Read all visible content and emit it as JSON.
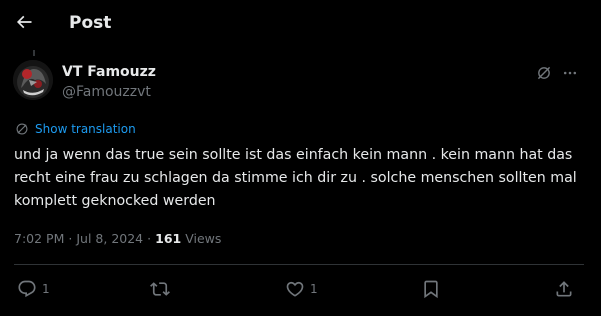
{
  "header": {
    "title": "Post",
    "back_icon": "arrow-left-icon"
  },
  "author": {
    "display_name": "VT Famouzz",
    "handle": "@Famouzzvt",
    "avatar_icon": "avatar-image"
  },
  "translation": {
    "label": "Show translation",
    "icon": "globe-icon"
  },
  "post": {
    "text": "und ja wenn das true sein sollte ist das einfach kein mann . kein mann hat das recht eine frau zu schlagen da stimme ich dir zu . solche menschen sollten mal komplett geknocked werden"
  },
  "meta": {
    "time": "7:02 PM",
    "separator": "·",
    "date": "Jul 8, 2024",
    "views_count": "161",
    "views_label": "Views"
  },
  "actions": {
    "replies": "1",
    "likes": "1"
  },
  "colors": {
    "background": "#000000",
    "text": "#e7e9ea",
    "muted": "#71767b",
    "accent": "#1d9bf0",
    "divider": "#2f3336"
  }
}
